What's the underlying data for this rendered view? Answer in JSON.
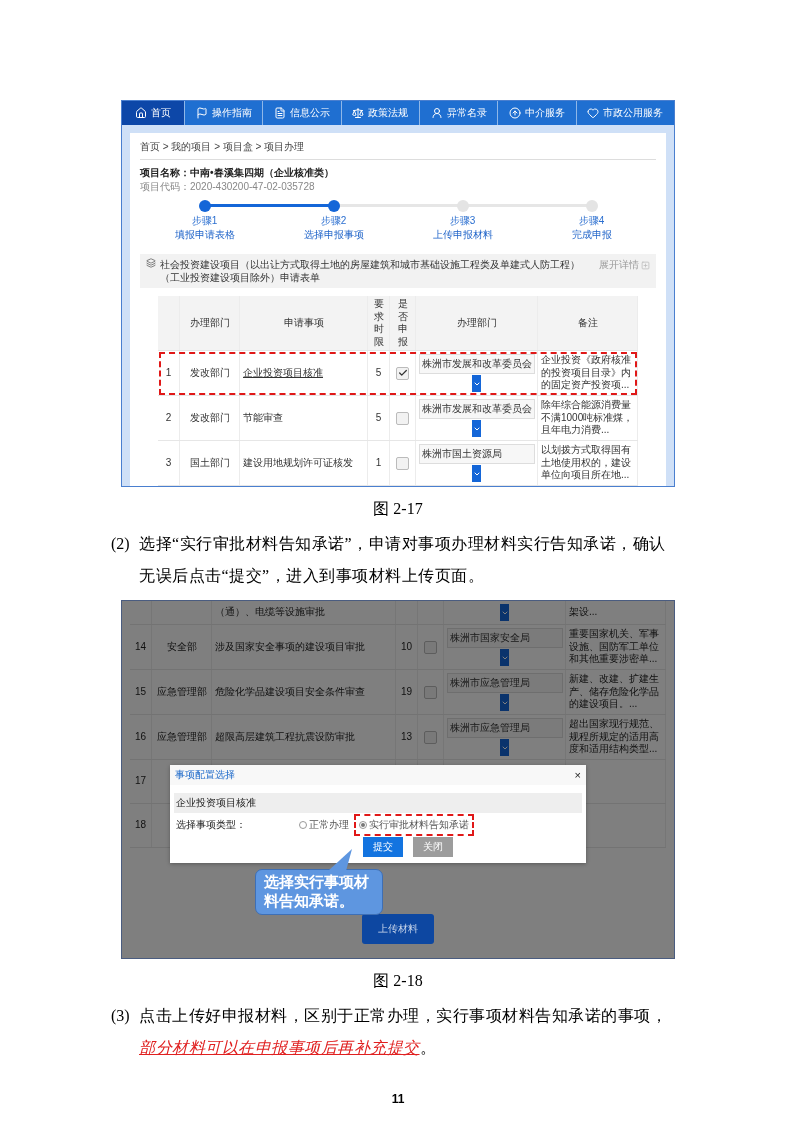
{
  "figure1": {
    "nav": [
      {
        "label": "首页",
        "selected": true
      },
      {
        "label": "操作指南",
        "selected": false
      },
      {
        "label": "信息公示",
        "selected": false
      },
      {
        "label": "政策法规",
        "selected": false
      },
      {
        "label": "异常名录",
        "selected": false
      },
      {
        "label": "中介服务",
        "selected": false
      },
      {
        "label": "市政公用服务",
        "selected": false
      }
    ],
    "breadcrumb": "首页 > 我的项目 > 项目盒 > 项目办理",
    "project_name": "项目名称：中南•春溪集四期（企业核准类）",
    "project_code": "项目代码：2020-430200-47-02-035728",
    "steps": [
      {
        "step": "步骤1",
        "label": "填报申请表格",
        "done": true
      },
      {
        "step": "步骤2",
        "label": "选择申报事项",
        "done": true
      },
      {
        "step": "步骤3",
        "label": "上传申报材料",
        "done": false
      },
      {
        "step": "步骤4",
        "label": "完成申报",
        "done": false
      }
    ],
    "form_title": "社会投资建设项目（以出让方式取得土地的房屋建筑和城市基础设施工程类及单建式人防工程）（工业投资建设项目除外）申请表单",
    "expand_label": "展开详情",
    "columns": [
      "办理部门",
      "申请事项",
      "要求时限",
      "是否申报",
      "办理部门",
      "备注"
    ],
    "rows": [
      {
        "no": "1",
        "dept": "发改部门",
        "item": "企业投资项目核准",
        "days": "5",
        "checked": true,
        "office": "株洲市发展和改革委员会",
        "note": "企业投资《政府核准的投资项目目录》内的固定资产投资项...",
        "highlighted": true
      },
      {
        "no": "2",
        "dept": "发改部门",
        "item": "节能审查",
        "days": "5",
        "checked": false,
        "office": "株洲市发展和改革委员会",
        "note": "除年综合能源消费量不满1000吨标准煤，且年电力消费...",
        "highlighted": false
      },
      {
        "no": "3",
        "dept": "国土部门",
        "item": "建设用地规划许可证核发",
        "days": "1",
        "checked": false,
        "office": "株洲市国土资源局",
        "note": "以划拨方式取得国有土地使用权的，建设单位向项目所在地...",
        "highlighted": false
      }
    ]
  },
  "caption1": "图 2-17",
  "paragraph2": {
    "marker": "(2)",
    "segments": [
      {
        "text": "选择“实行审批材料告知承诺”，申请对事项办理材料实行告知承诺，确认无误后点击“提交”，进入到事项材料上传页面。",
        "emphasis": false
      }
    ]
  },
  "figure2": {
    "dimmed": true,
    "rows": [
      {
        "item": "（通）、电缆等设施审批",
        "note": "架设..."
      },
      {
        "no": "14",
        "dept": "安全部",
        "item": "涉及国家安全事项的建设项目审批",
        "days": "10",
        "checked": false,
        "office": "株洲市国家安全局",
        "note": "重要国家机关、军事设施、国防军工单位和其他重要涉密单..."
      },
      {
        "no": "15",
        "dept": "应急管理部",
        "item": "危险化学品建设项目安全条件审查",
        "days": "19",
        "checked": false,
        "office": "株洲市应急管理局",
        "note": "新建、改建、扩建生产、储存危险化学品的建设项目。..."
      },
      {
        "no": "16",
        "dept": "应急管理部",
        "item": "超限高层建筑工程抗震设防审批",
        "days": "13",
        "checked": false,
        "office": "株洲市应急管理局",
        "note": "超出国家现行规范、规程所规定的适用高度和适用结构类型..."
      },
      {
        "no": "17"
      },
      {
        "no": "18"
      }
    ],
    "modal": {
      "title": "事项配置选择",
      "close": "×",
      "section": "企业投资项目核准",
      "field_label": "选择事项类型：",
      "options": [
        {
          "label": "正常办理",
          "selected": false,
          "highlighted": false
        },
        {
          "label": "实行审批材料告知承诺",
          "selected": true,
          "highlighted": true
        }
      ],
      "buttons": [
        {
          "label": "提交",
          "kind": "primary"
        },
        {
          "label": "关闭",
          "kind": "secondary"
        }
      ]
    },
    "callout": "选择实行事项材料告知承诺。",
    "upload_button": "上传材料"
  },
  "caption2": "图 2-18",
  "paragraph3": {
    "marker": "(3)",
    "segments": [
      {
        "text": "点击上传好申报材料，区别于正常办理，实行事项材料告知承诺的事项，",
        "emphasis": false
      },
      {
        "text": "部分材料可以在申报事项后再补充提交",
        "emphasis": true
      },
      {
        "text": "。",
        "emphasis": false
      }
    ]
  },
  "page_number": "11"
}
